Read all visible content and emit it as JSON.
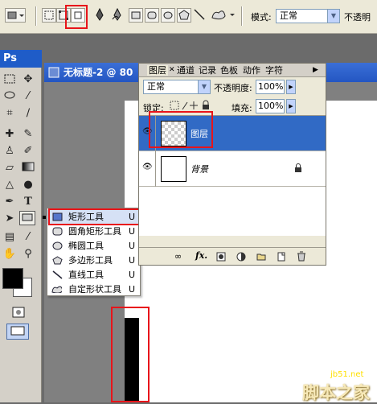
{
  "options_bar": {
    "mode_label": "模式:",
    "mode_value": "正常",
    "opacity_label": "不透明"
  },
  "toolbox": {
    "ps_label": "Ps"
  },
  "document": {
    "title": "无标题-2 @ 80"
  },
  "layers_panel": {
    "tabs": [
      "图层",
      "通道",
      "记录",
      "色板",
      "动作",
      "字符"
    ],
    "blend_mode": "正常",
    "opacity_label": "不透明度:",
    "opacity_value": "100%",
    "lock_label": "锁定:",
    "fill_label": "填充:",
    "fill_value": "100%",
    "layers": [
      {
        "name": "图层",
        "selected": true
      },
      {
        "name": "背景",
        "selected": false
      }
    ]
  },
  "shape_flyout": {
    "items": [
      {
        "label": "矩形工具",
        "key": "U",
        "icon": "rectangle-icon"
      },
      {
        "label": "圆角矩形工具",
        "key": "U",
        "icon": "rounded-rectangle-icon"
      },
      {
        "label": "椭圆工具",
        "key": "U",
        "icon": "ellipse-icon"
      },
      {
        "label": "多边形工具",
        "key": "U",
        "icon": "polygon-icon"
      },
      {
        "label": "直线工具",
        "key": "U",
        "icon": "line-icon"
      },
      {
        "label": "自定形状工具",
        "key": "U",
        "icon": "custom-shape-icon"
      }
    ]
  },
  "watermark": {
    "url": "jb51.net",
    "site": "脚本之家"
  },
  "colors": {
    "highlight": "#e8141a",
    "selection": "#316ac5",
    "title_bar": "#2456c2"
  }
}
